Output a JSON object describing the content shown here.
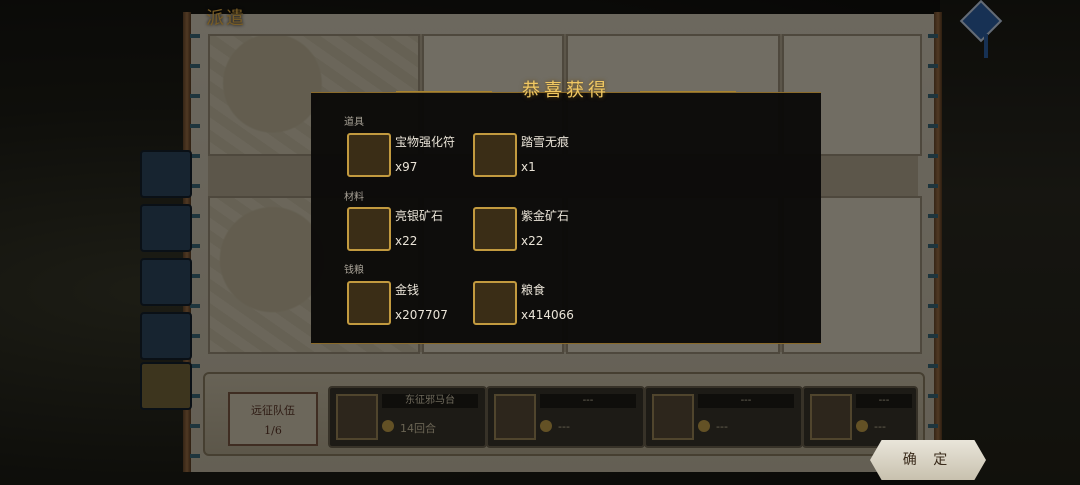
{
  "screen": {
    "title": "派遣"
  },
  "reward_popup": {
    "title": "恭喜获得",
    "sections": [
      {
        "label": "道具",
        "items": [
          {
            "name": "宝物强化符",
            "qty": "x97",
            "icon": "talisman-icon"
          },
          {
            "name": "踏雪无痕",
            "qty": "x1",
            "icon": "white-horse-icon"
          }
        ]
      },
      {
        "label": "材料",
        "items": [
          {
            "name": "亮银矿石",
            "qty": "x22",
            "icon": "silver-ore-icon"
          },
          {
            "name": "紫金矿石",
            "qty": "x22",
            "icon": "purple-gold-ore-icon"
          }
        ]
      },
      {
        "label": "钱粮",
        "items": [
          {
            "name": "金钱",
            "qty": "x207707",
            "icon": "gold-coin-icon"
          },
          {
            "name": "粮食",
            "qty": "x414066",
            "icon": "grain-icon"
          }
        ]
      }
    ]
  },
  "team": {
    "label": "远征队伍",
    "count": "1/6",
    "slots": [
      {
        "name": "东征邪马台",
        "detail": "14回合"
      },
      {
        "name": "---",
        "detail": "---"
      },
      {
        "name": "---",
        "detail": "---"
      },
      {
        "name": "---",
        "detail": "---"
      }
    ]
  },
  "confirm_label": "确 定"
}
